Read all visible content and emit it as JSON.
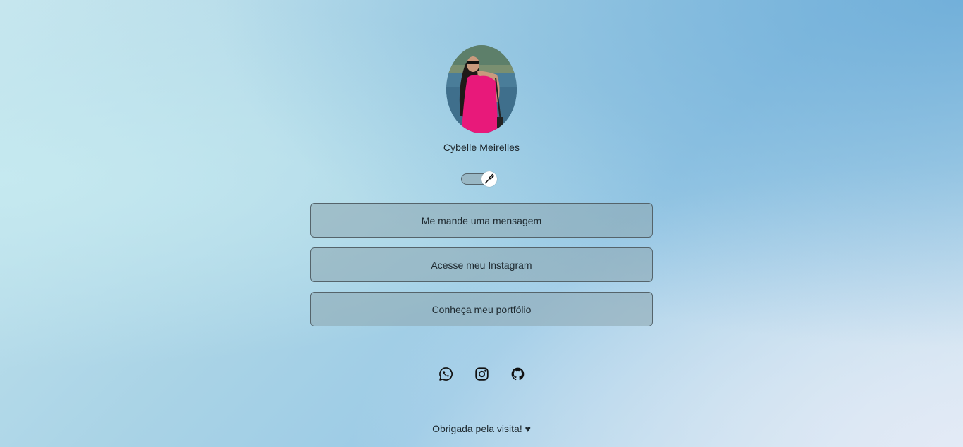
{
  "profile": {
    "name": "Cybelle Meirelles",
    "avatar_icon": "profile-photo"
  },
  "theme_toggle": {
    "icon": "flashlight-icon",
    "state": "off"
  },
  "links": [
    {
      "label": "Me mande uma mensagem"
    },
    {
      "label": "Acesse meu Instagram"
    },
    {
      "label": "Conheça meu portfólio"
    }
  ],
  "socials": [
    {
      "icon": "whatsapp-icon"
    },
    {
      "icon": "instagram-icon"
    },
    {
      "icon": "github-icon"
    }
  ],
  "footer": {
    "text": "Obrigada pela visita! ♥"
  },
  "colors": {
    "button_border": "#55646b",
    "text": "#1f2a30",
    "dress": "#e8197a"
  }
}
